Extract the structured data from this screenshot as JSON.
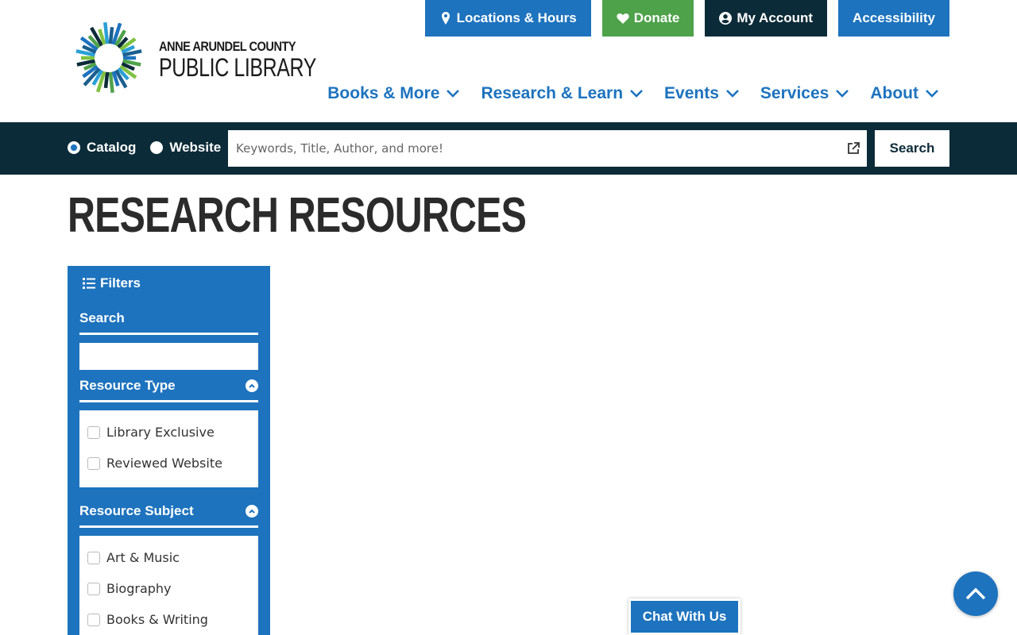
{
  "header": {
    "logo": {
      "line1": "ANNE ARUNDEL COUNTY",
      "line2": "PUBLIC LIBRARY"
    },
    "utility_nav": [
      {
        "label": "Locations & Hours",
        "icon": "map-pin-icon",
        "color": "#1d73be"
      },
      {
        "label": "Donate",
        "icon": "heart-icon",
        "color": "#4ea24a"
      },
      {
        "label": "My Account",
        "icon": "user-circle-icon",
        "color": "#0c2b38"
      },
      {
        "label": "Accessibility",
        "icon": "",
        "color": "#1d73be"
      }
    ],
    "main_nav": [
      {
        "label": "Books & More"
      },
      {
        "label": "Research & Learn"
      },
      {
        "label": "Events"
      },
      {
        "label": "Services"
      },
      {
        "label": "About"
      }
    ]
  },
  "search": {
    "options": [
      {
        "label": "Catalog",
        "checked": true
      },
      {
        "label": "Website",
        "checked": false
      }
    ],
    "placeholder": "Keywords, Title, Author, and more!",
    "button_label": "Search"
  },
  "page": {
    "title": "RESEARCH RESOURCES"
  },
  "filters": {
    "heading": "Filters",
    "search_label": "Search",
    "resource_type": {
      "label": "Resource Type",
      "options": [
        "Library Exclusive",
        "Reviewed Website"
      ]
    },
    "resource_subject": {
      "label": "Resource Subject",
      "options": [
        "Art & Music",
        "Biography",
        "Books & Writing"
      ]
    }
  },
  "chat": {
    "label": "Chat With Us"
  },
  "colors": {
    "brand_blue": "#1d73be",
    "dark_navy": "#0c2b38",
    "green": "#4ea24a"
  }
}
